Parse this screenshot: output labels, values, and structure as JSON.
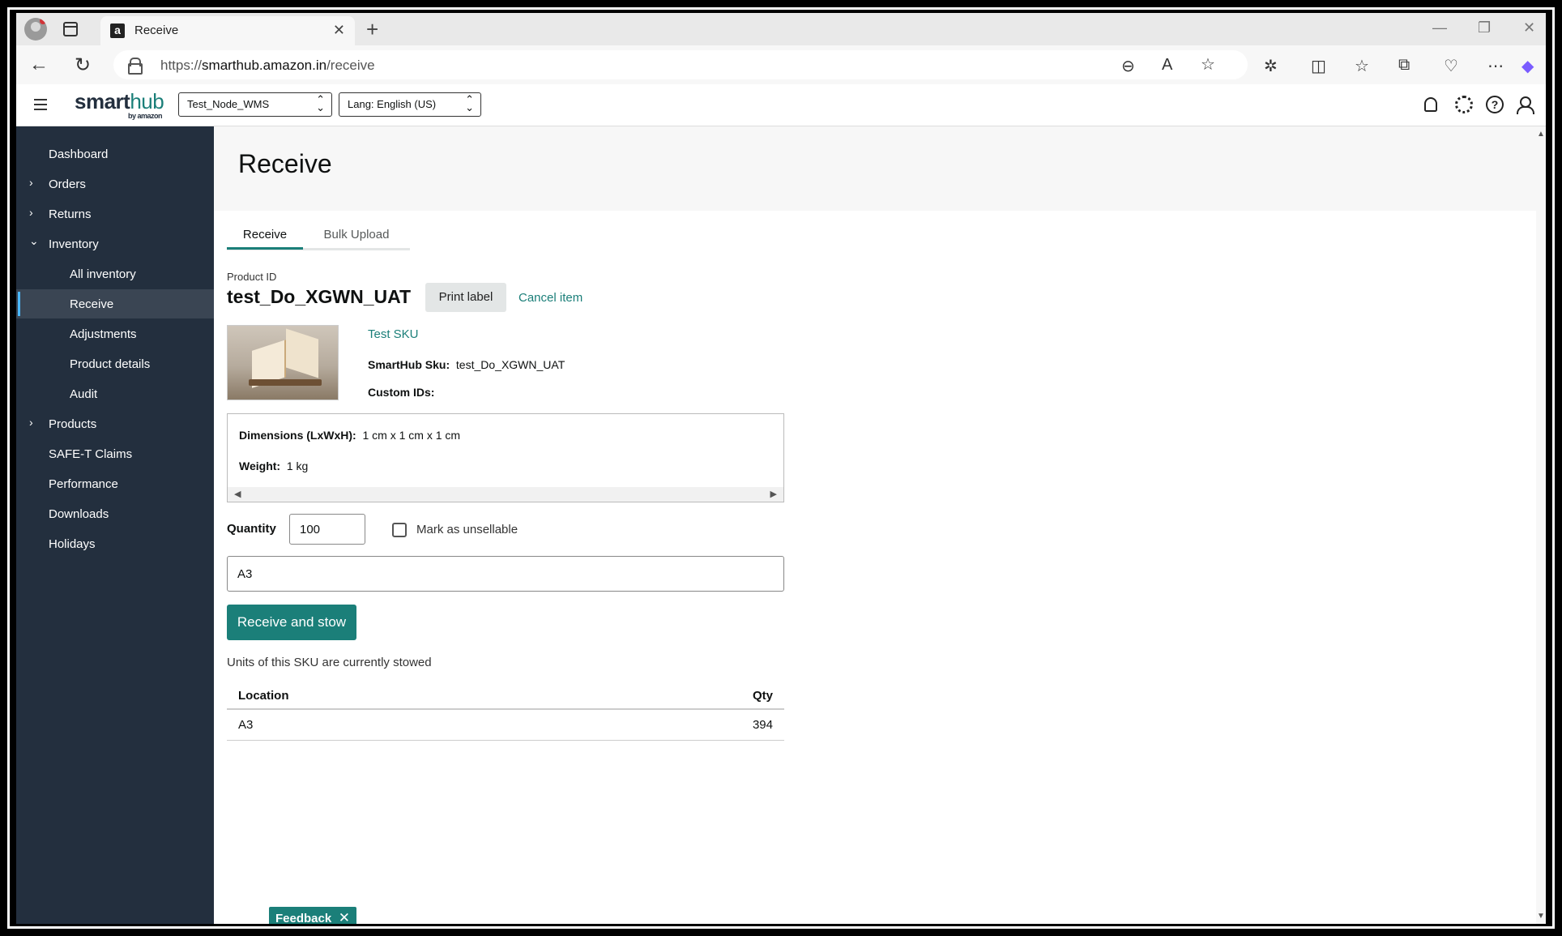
{
  "browser": {
    "tab_title": "Receive",
    "favicon_letter": "a",
    "url_prefix": "https://",
    "url_host": "smarthub.amazon.in",
    "url_path": "/receive",
    "new_tab_symbol": "+",
    "close_symbol": "✕",
    "minimize_symbol": "—",
    "restore_symbol": "❐",
    "window_close_symbol": "✕"
  },
  "header": {
    "logo_main": "smart",
    "logo_hub": "hub",
    "logo_by": "by amazon",
    "node_select": "Test_Node_WMS",
    "lang_select": "Lang: English (US)",
    "help_symbol": "?"
  },
  "sidebar": {
    "items": [
      {
        "label": "Dashboard"
      },
      {
        "label": "Orders"
      },
      {
        "label": "Returns"
      },
      {
        "label": "Inventory"
      },
      {
        "label": "All inventory"
      },
      {
        "label": "Receive"
      },
      {
        "label": "Adjustments"
      },
      {
        "label": "Product details"
      },
      {
        "label": "Audit"
      },
      {
        "label": "Products"
      },
      {
        "label": "SAFE-T Claims"
      },
      {
        "label": "Performance"
      },
      {
        "label": "Downloads"
      },
      {
        "label": "Holidays"
      }
    ]
  },
  "main": {
    "page_title": "Receive",
    "tabs": [
      {
        "label": "Receive"
      },
      {
        "label": "Bulk Upload"
      }
    ],
    "product_id_label": "Product ID",
    "product_id": "test_Do_XGWN_UAT",
    "print_label": "Print label",
    "cancel_item": "Cancel item",
    "sku_title": "Test SKU",
    "smarthub_sku_label": "SmartHub Sku:",
    "smarthub_sku_value": "test_Do_XGWN_UAT",
    "custom_ids_label": "Custom IDs:",
    "dimensions_label": "Dimensions (LxWxH):",
    "dimensions_value": "1 cm x 1 cm x 1 cm",
    "weight_label": "Weight:",
    "weight_value": "1 kg",
    "quantity_label": "Quantity",
    "quantity_value": "100",
    "unsellable_label": "Mark as unsellable",
    "location_value": "A3",
    "receive_button": "Receive and stow",
    "stowed_note": "Units of this SKU are currently stowed",
    "table": {
      "columns": [
        "Location",
        "Qty"
      ],
      "rows": [
        {
          "location": "A3",
          "qty": "394"
        }
      ]
    },
    "feedback": "Feedback"
  },
  "colors": {
    "accent": "#1b7f79",
    "sidebar_bg": "#232f3e",
    "sidebar_active_bar": "#4ab8ff"
  }
}
